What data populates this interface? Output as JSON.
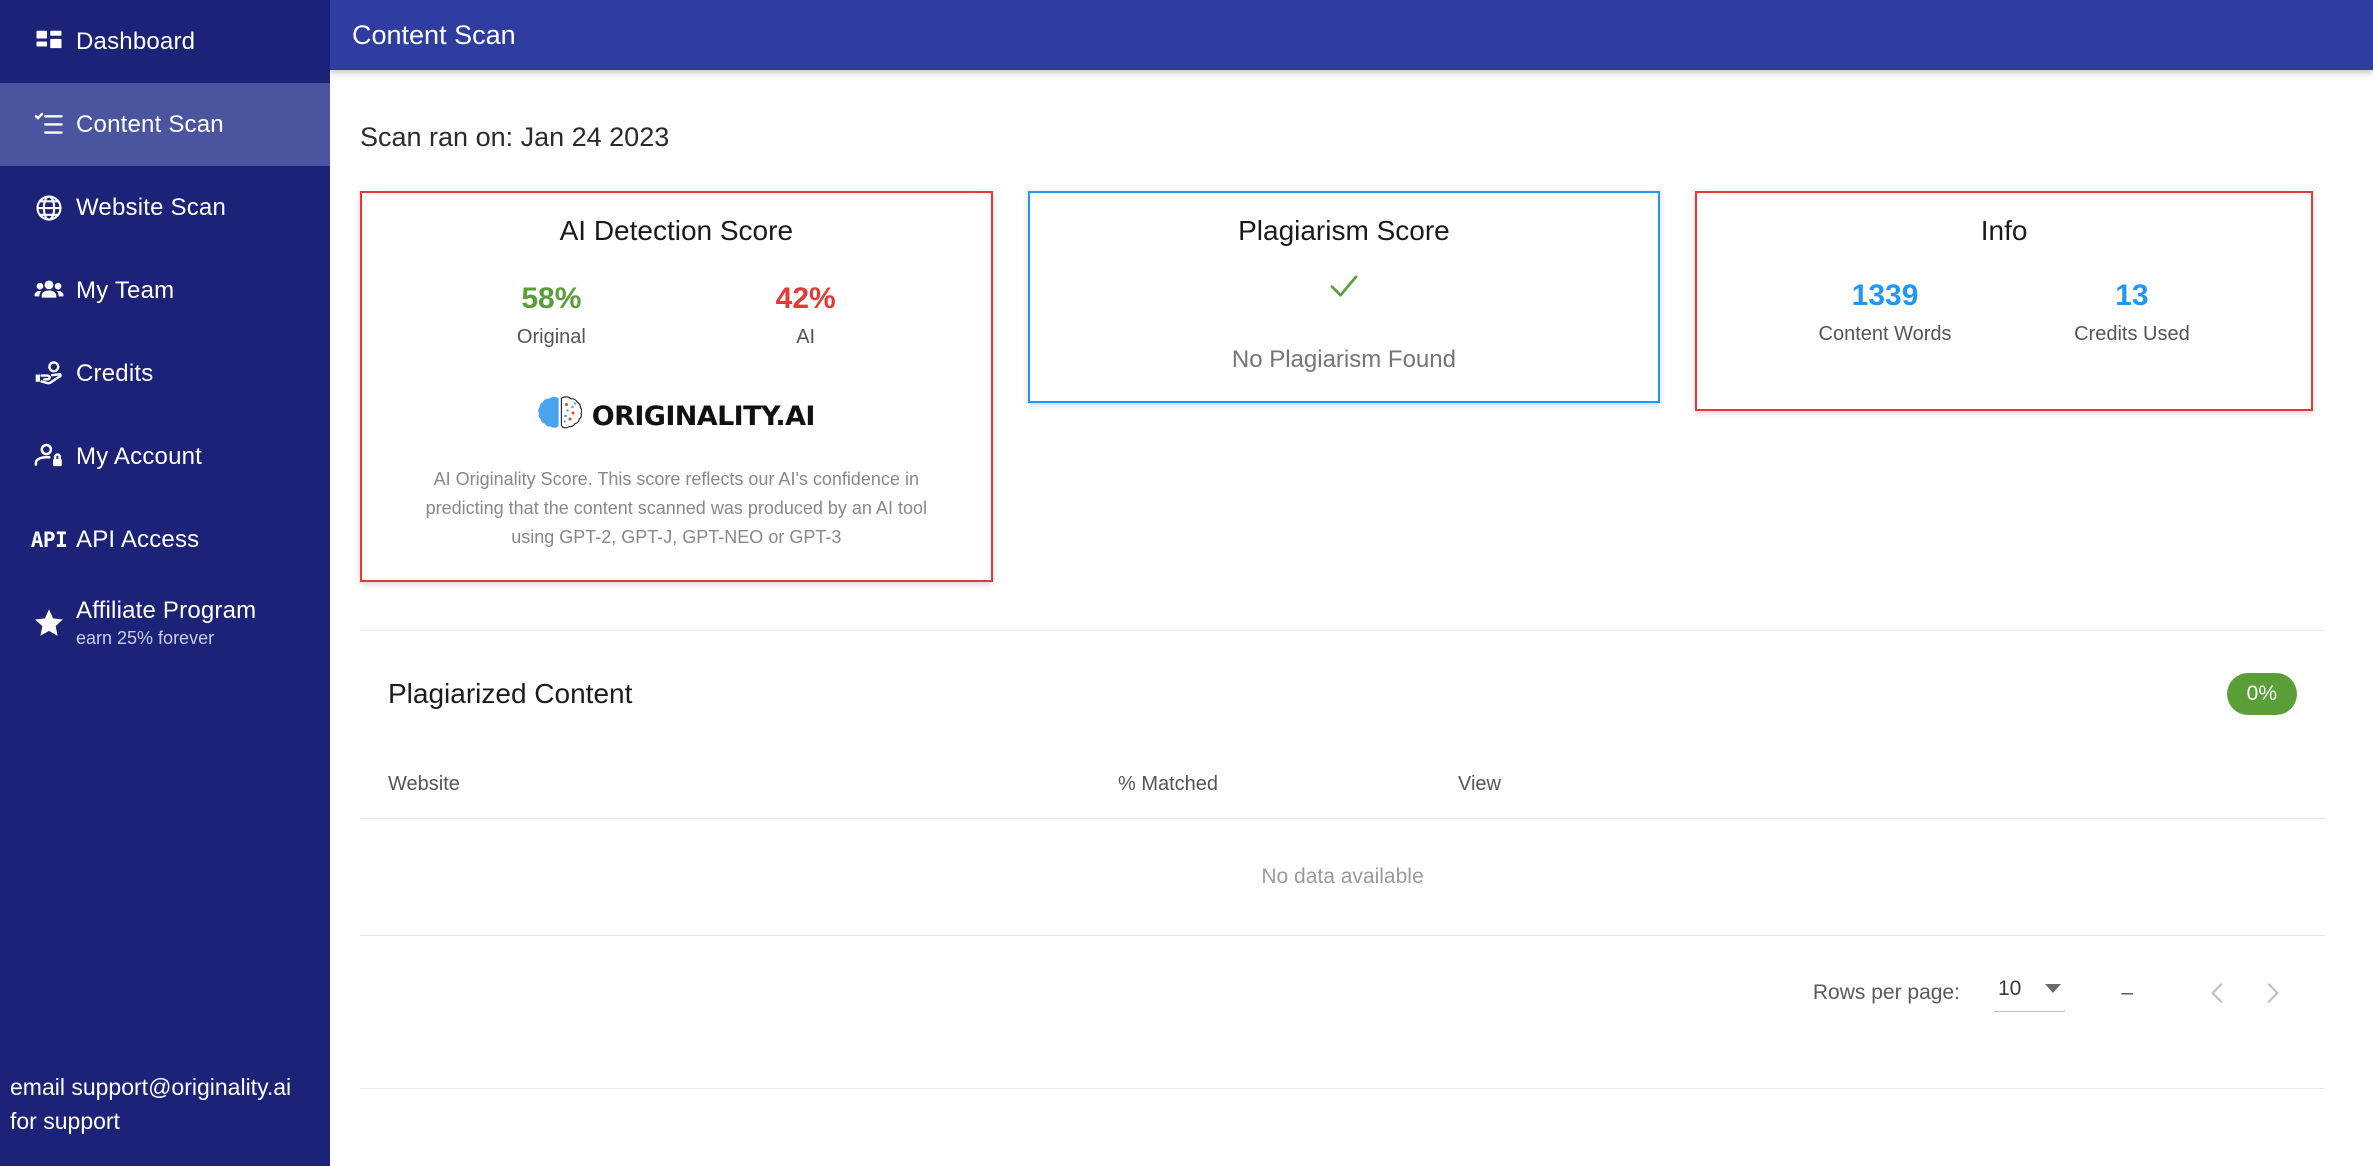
{
  "colors": {
    "sidebar_bg": "#1c2277",
    "sidebar_active": "#4b559f",
    "topbar_bg": "#2e3d9f",
    "accent_red": "#e53935",
    "accent_blue": "#2196f3",
    "accent_green": "#5a9e38"
  },
  "sidebar": {
    "items": [
      {
        "label": "Dashboard",
        "icon": "dashboard-grid-icon",
        "sub": "",
        "active": false
      },
      {
        "label": "Content Scan",
        "icon": "checklist-icon",
        "sub": "",
        "active": true
      },
      {
        "label": "Website Scan",
        "icon": "globe-icon",
        "sub": "",
        "active": false
      },
      {
        "label": "My Team",
        "icon": "people-group-icon",
        "sub": "",
        "active": false
      },
      {
        "label": "Credits",
        "icon": "hand-coin-icon",
        "sub": "",
        "active": false
      },
      {
        "label": "My Account",
        "icon": "person-lock-icon",
        "sub": "",
        "active": false
      },
      {
        "label": "API Access",
        "icon": "api-text-icon",
        "sub": "",
        "active": false
      },
      {
        "label": "Affiliate Program",
        "icon": "star-icon",
        "sub": "earn 25% forever",
        "active": false
      }
    ],
    "footer_text": "email support@originality.ai for support"
  },
  "topbar": {
    "title": "Content Scan"
  },
  "page": {
    "scan_date_line": "Scan ran on: Jan 24 2023"
  },
  "ai_card": {
    "title": "AI Detection Score",
    "original_value": "58%",
    "original_label": "Original",
    "ai_value": "42%",
    "ai_label": "AI",
    "logo_text": "ORIGINALITY.AI",
    "description": "AI Originality Score. This score reflects our AI's confidence in predicting that the content scanned was produced by an AI tool using GPT-2, GPT-J, GPT-NEO or GPT-3"
  },
  "plagiarism_card": {
    "title": "Plagiarism Score",
    "status_icon": "check-mark-icon",
    "message": "No Plagiarism Found"
  },
  "info_card": {
    "title": "Info",
    "stats": [
      {
        "value": "1339",
        "label": "Content Words"
      },
      {
        "value": "13",
        "label": "Credits Used"
      }
    ]
  },
  "plagiarized_table": {
    "title": "Plagiarized Content",
    "badge": "0%",
    "columns": [
      "Website",
      "% Matched",
      "View"
    ],
    "rows": [],
    "empty_message": "No data available",
    "pagination": {
      "rows_per_page_label": "Rows per page:",
      "rows_per_page_value": "10",
      "range_text": "–",
      "prev_icon": "chevron-left-icon",
      "next_icon": "chevron-right-icon"
    }
  }
}
